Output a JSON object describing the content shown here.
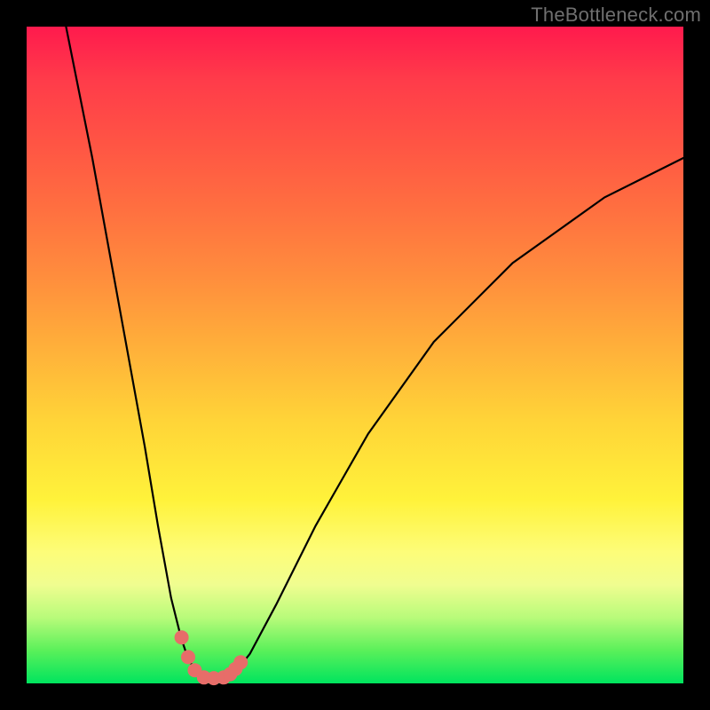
{
  "watermark": "TheBottleneck.com",
  "colors": {
    "gradient_top": "#ff1a4d",
    "gradient_bottom": "#00e45e",
    "curve": "#000000",
    "dots": "#e76d69",
    "frame": "#000000"
  },
  "chart_data": {
    "type": "line",
    "title": "",
    "xlabel": "",
    "ylabel": "",
    "xlim": [
      0,
      100
    ],
    "ylim": [
      0,
      100
    ],
    "grid": false,
    "legend": false,
    "series": [
      {
        "name": "bottleneck-curve",
        "x": [
          6,
          10,
          14,
          18,
          20,
          22,
          23.5,
          24.5,
          25.5,
          27,
          28.5,
          30,
          31,
          32,
          34,
          38,
          44,
          52,
          62,
          74,
          88,
          100
        ],
        "y": [
          100,
          80,
          58,
          36,
          24,
          13,
          7,
          4,
          2.2,
          1.0,
          0.8,
          0.9,
          1.2,
          2.0,
          4.5,
          12,
          24,
          38,
          52,
          64,
          74,
          80
        ]
      }
    ],
    "annotations": {
      "dots": [
        {
          "x": 23.6,
          "y": 7.0
        },
        {
          "x": 24.6,
          "y": 4.0
        },
        {
          "x": 25.6,
          "y": 2.0
        },
        {
          "x": 27.0,
          "y": 0.9
        },
        {
          "x": 28.5,
          "y": 0.8
        },
        {
          "x": 30.0,
          "y": 0.9
        },
        {
          "x": 31.0,
          "y": 1.4
        },
        {
          "x": 31.8,
          "y": 2.2
        },
        {
          "x": 32.6,
          "y": 3.2
        }
      ]
    }
  }
}
